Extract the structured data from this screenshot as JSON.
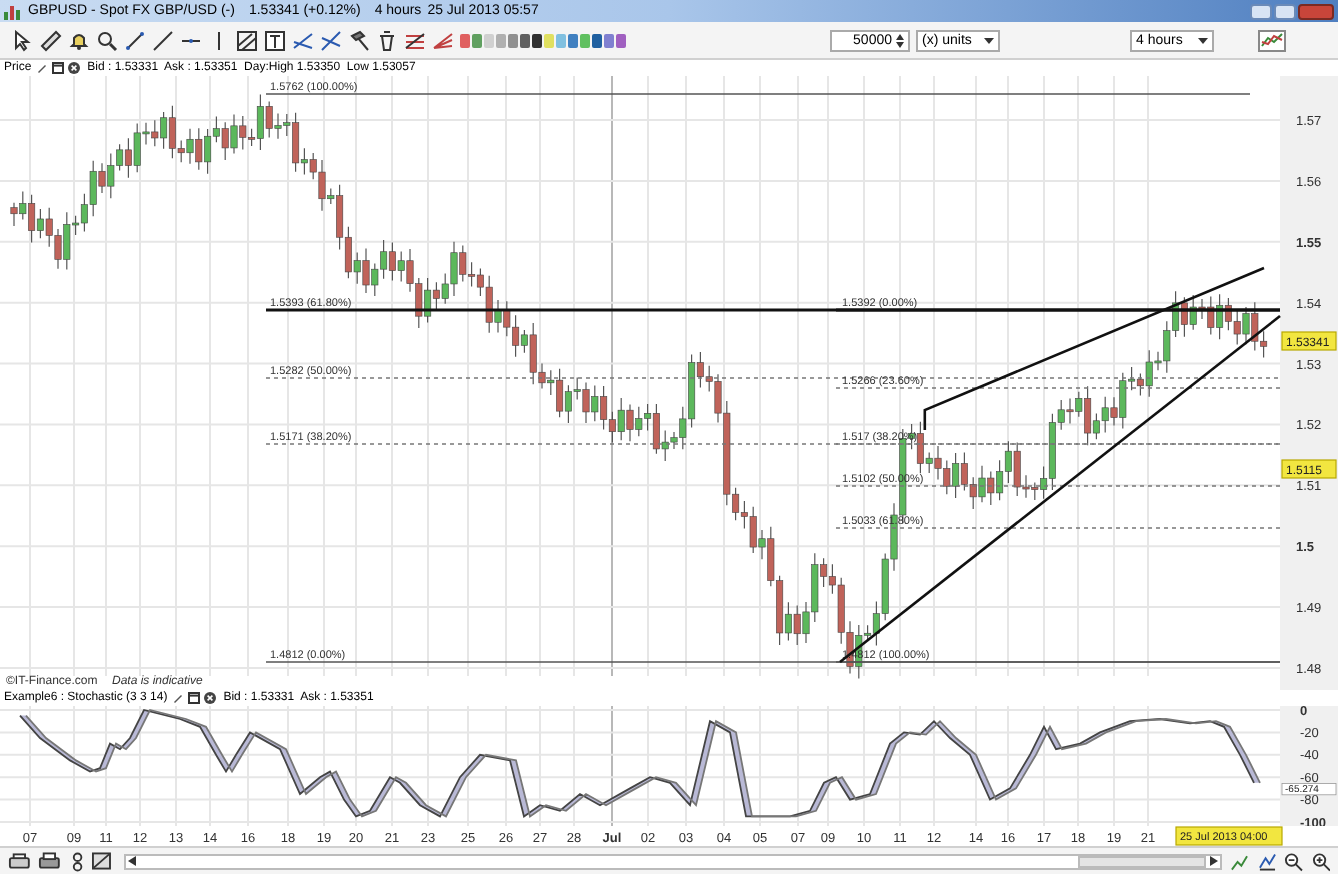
{
  "window": {
    "title": "GBPUSD - Spot FX GBP/USD (-)",
    "quote": "1.53341 (+0.12%)",
    "interval": "4 hours",
    "timestamp": "25 Jul 2013 05:57"
  },
  "toolbar": {
    "amount": "50000",
    "units": "(x) units",
    "timeframe": "4 hours"
  },
  "price_panel": {
    "label": "Price",
    "quote": "Bid : 1.53331  Ask : 1.53351  Day:High 1.53350  Low 1.53057",
    "fib_left": [
      {
        "label": "1.5762 (100.00%)",
        "kind": "solid"
      },
      {
        "label": "1.5393 (61.80%)",
        "kind": "thick"
      },
      {
        "label": "1.5282 (50.00%)",
        "kind": "dotted"
      },
      {
        "label": "1.5171 (38.20%)",
        "kind": "dotted"
      },
      {
        "label": "1.4812 (0.00%)",
        "kind": "solid"
      }
    ],
    "fib_right": [
      {
        "label": "1.5392 (0.00%)",
        "kind": "thick"
      },
      {
        "label": "1.5266 (23.60%)",
        "kind": "dotted"
      },
      {
        "label": "1.517 (38.20%)",
        "kind": "dotted"
      },
      {
        "label": "1.5102 (50.00%)",
        "kind": "dotted"
      },
      {
        "label": "1.5033 (61.80%)",
        "kind": "dotted"
      },
      {
        "label": "1.4812 (100.00%)",
        "kind": "solid"
      }
    ],
    "axis": [
      {
        "label": "1.57",
        "major": false
      },
      {
        "label": "1.56",
        "major": false
      },
      {
        "label": "1.55",
        "major": true
      },
      {
        "label": "1.54",
        "major": false
      },
      {
        "label": "1.53",
        "major": false
      },
      {
        "label": "1.52",
        "major": false
      },
      {
        "label": "1.51",
        "major": false
      },
      {
        "label": "1.5",
        "major": true
      },
      {
        "label": "1.49",
        "major": false
      },
      {
        "label": "1.48",
        "major": false
      }
    ],
    "badges": [
      "1.53341",
      "1.5115"
    ],
    "source": "©IT-Finance.com",
    "note": "Data is indicative"
  },
  "stochastic_panel": {
    "title": "Example6 : Stochastic (3 3 14)",
    "quote": "Bid : 1.53331  Ask : 1.53351",
    "axis": [
      "0",
      "-20",
      "-40",
      "-60",
      "-80",
      "-100"
    ],
    "reading": "-65.274"
  },
  "date_axis": {
    "labels": [
      {
        "label": "07",
        "major": false
      },
      {
        "label": "09",
        "major": false
      },
      {
        "label": "11",
        "major": false
      },
      {
        "label": "12",
        "major": false
      },
      {
        "label": "13",
        "major": false
      },
      {
        "label": "14",
        "major": false
      },
      {
        "label": "16",
        "major": false
      },
      {
        "label": "18",
        "major": false
      },
      {
        "label": "19",
        "major": false
      },
      {
        "label": "20",
        "major": false
      },
      {
        "label": "21",
        "major": false
      },
      {
        "label": "23",
        "major": false
      },
      {
        "label": "25",
        "major": false
      },
      {
        "label": "26",
        "major": false
      },
      {
        "label": "27",
        "major": false
      },
      {
        "label": "28",
        "major": false
      },
      {
        "label": "Jul",
        "major": true
      },
      {
        "label": "02",
        "major": false
      },
      {
        "label": "03",
        "major": false
      },
      {
        "label": "04",
        "major": false
      },
      {
        "label": "05",
        "major": false
      },
      {
        "label": "07",
        "major": false
      },
      {
        "label": "09",
        "major": false
      },
      {
        "label": "10",
        "major": false
      },
      {
        "label": "11",
        "major": false
      },
      {
        "label": "12",
        "major": false
      },
      {
        "label": "14",
        "major": false
      },
      {
        "label": "16",
        "major": false
      },
      {
        "label": "17",
        "major": false
      },
      {
        "label": "18",
        "major": false
      },
      {
        "label": "19",
        "major": false
      },
      {
        "label": "21",
        "major": false
      }
    ],
    "cursor": "25 Jul 2013 04:00"
  }
}
